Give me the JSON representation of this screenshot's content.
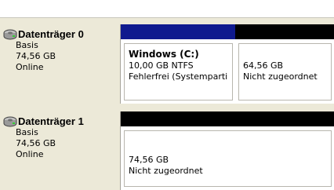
{
  "disks": [
    {
      "title": "Datenträger 0",
      "type": "Basis",
      "size": "74,56 GB",
      "status": "Online",
      "icon": "disk-drive-icon",
      "partitions": [
        {
          "bar_color": "#0f1a8e",
          "name": "Windows  (C:)",
          "line1": "10,00 GB NTFS",
          "line2": "Fehlerfrei (Systemparti"
        },
        {
          "bar_color": "#000000",
          "line1": "64,56 GB",
          "line2": "Nicht zugeordnet"
        }
      ]
    },
    {
      "title": "Datenträger 1",
      "type": "Basis",
      "size": "74,56 GB",
      "status": "Online",
      "icon": "disk-drive-icon",
      "partitions": [
        {
          "bar_color": "#000000",
          "line1": "74,56 GB",
          "line2": "Nicht zugeordnet"
        }
      ]
    }
  ]
}
